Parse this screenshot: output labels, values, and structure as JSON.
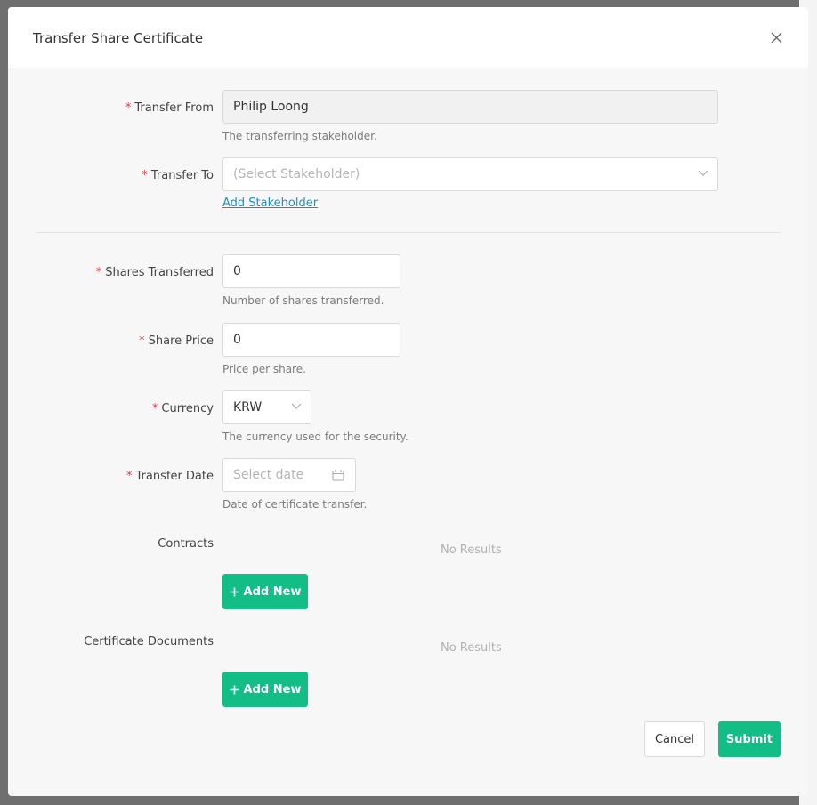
{
  "modal": {
    "title": "Transfer Share Certificate"
  },
  "fields": {
    "transfer_from": {
      "label": "Transfer From",
      "value": "Philip Loong",
      "help": "The transferring stakeholder."
    },
    "transfer_to": {
      "label": "Transfer To",
      "placeholder": "(Select Stakeholder)",
      "link": "Add Stakeholder"
    },
    "shares_transferred": {
      "label": "Shares Transferred",
      "value": "0",
      "help": "Number of shares transferred."
    },
    "share_price": {
      "label": "Share Price",
      "value": "0",
      "help": "Price per share."
    },
    "currency": {
      "label": "Currency",
      "value": "KRW",
      "help": "The currency used for the security."
    },
    "transfer_date": {
      "label": "Transfer Date",
      "placeholder": "Select date",
      "help": "Date of certificate transfer."
    },
    "contracts": {
      "label": "Contracts",
      "empty": "No Results",
      "add_label": "Add New"
    },
    "certificate_documents": {
      "label": "Certificate Documents",
      "empty": "No Results",
      "add_label": "Add New"
    }
  },
  "footer": {
    "cancel_label": "Cancel",
    "submit_label": "Submit"
  },
  "colors": {
    "primary": "#12be86",
    "required": "#e5383b",
    "link": "#1890c8"
  },
  "icons": {
    "close": "close-icon",
    "dropdown": "chevron-down-icon",
    "calendar": "calendar-icon",
    "add": "plus-icon"
  }
}
